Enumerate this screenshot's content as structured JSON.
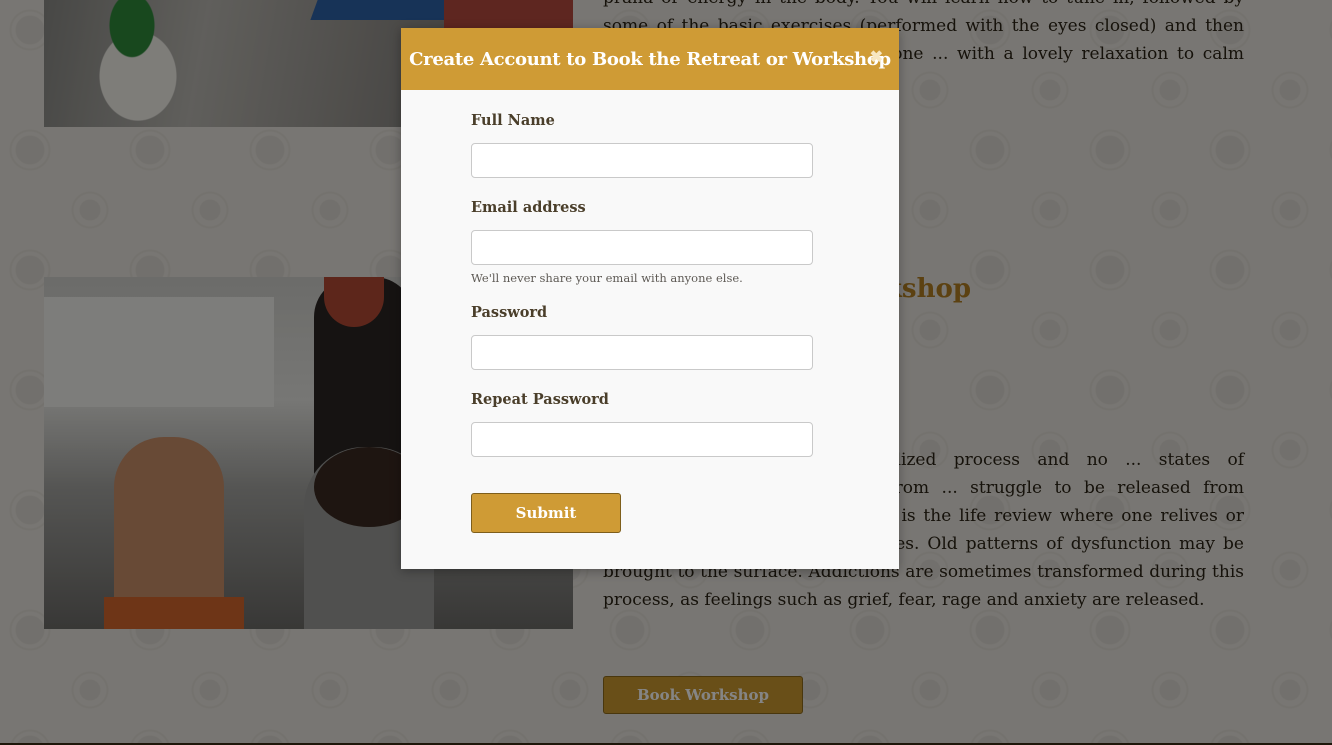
{
  "background": {
    "top_text": "prana or energy in the body. You will learn how to tune in, followed by some of the basic exercises (performed with the eyes closed) and then some mantra chanting will be done ... with a lovely relaxation to calm body and mind.",
    "heading": "rkshop",
    "body_text": "...urney is a highly individualized process and no ... states of consciousness reported range from ... struggle to be released from negative forces in ... urrence, as is the life review where one relives or observes their lifetime experiences. Old patterns of dysfunction may be brought to the surface. Addictions are sometimes transformed during this process, as feelings such as grief, fear, rage and anxiety are released.",
    "book_button": "Book Workshop"
  },
  "modal": {
    "title": "Create Account to Book the Retreat or Workshop",
    "close_icon": "✖",
    "fields": {
      "full_name": {
        "label": "Full Name",
        "value": "",
        "placeholder": ""
      },
      "email": {
        "label": "Email address",
        "value": "",
        "placeholder": "",
        "hint": "We'll never share your email with anyone else."
      },
      "password": {
        "label": "Password",
        "value": "",
        "placeholder": ""
      },
      "repeat_password": {
        "label": "Repeat Password",
        "value": "",
        "placeholder": ""
      }
    },
    "submit_label": "Submit"
  },
  "colors": {
    "accent": "#cf9b35",
    "heading_gold": "#b07d21",
    "text_dark": "#2b2416"
  }
}
